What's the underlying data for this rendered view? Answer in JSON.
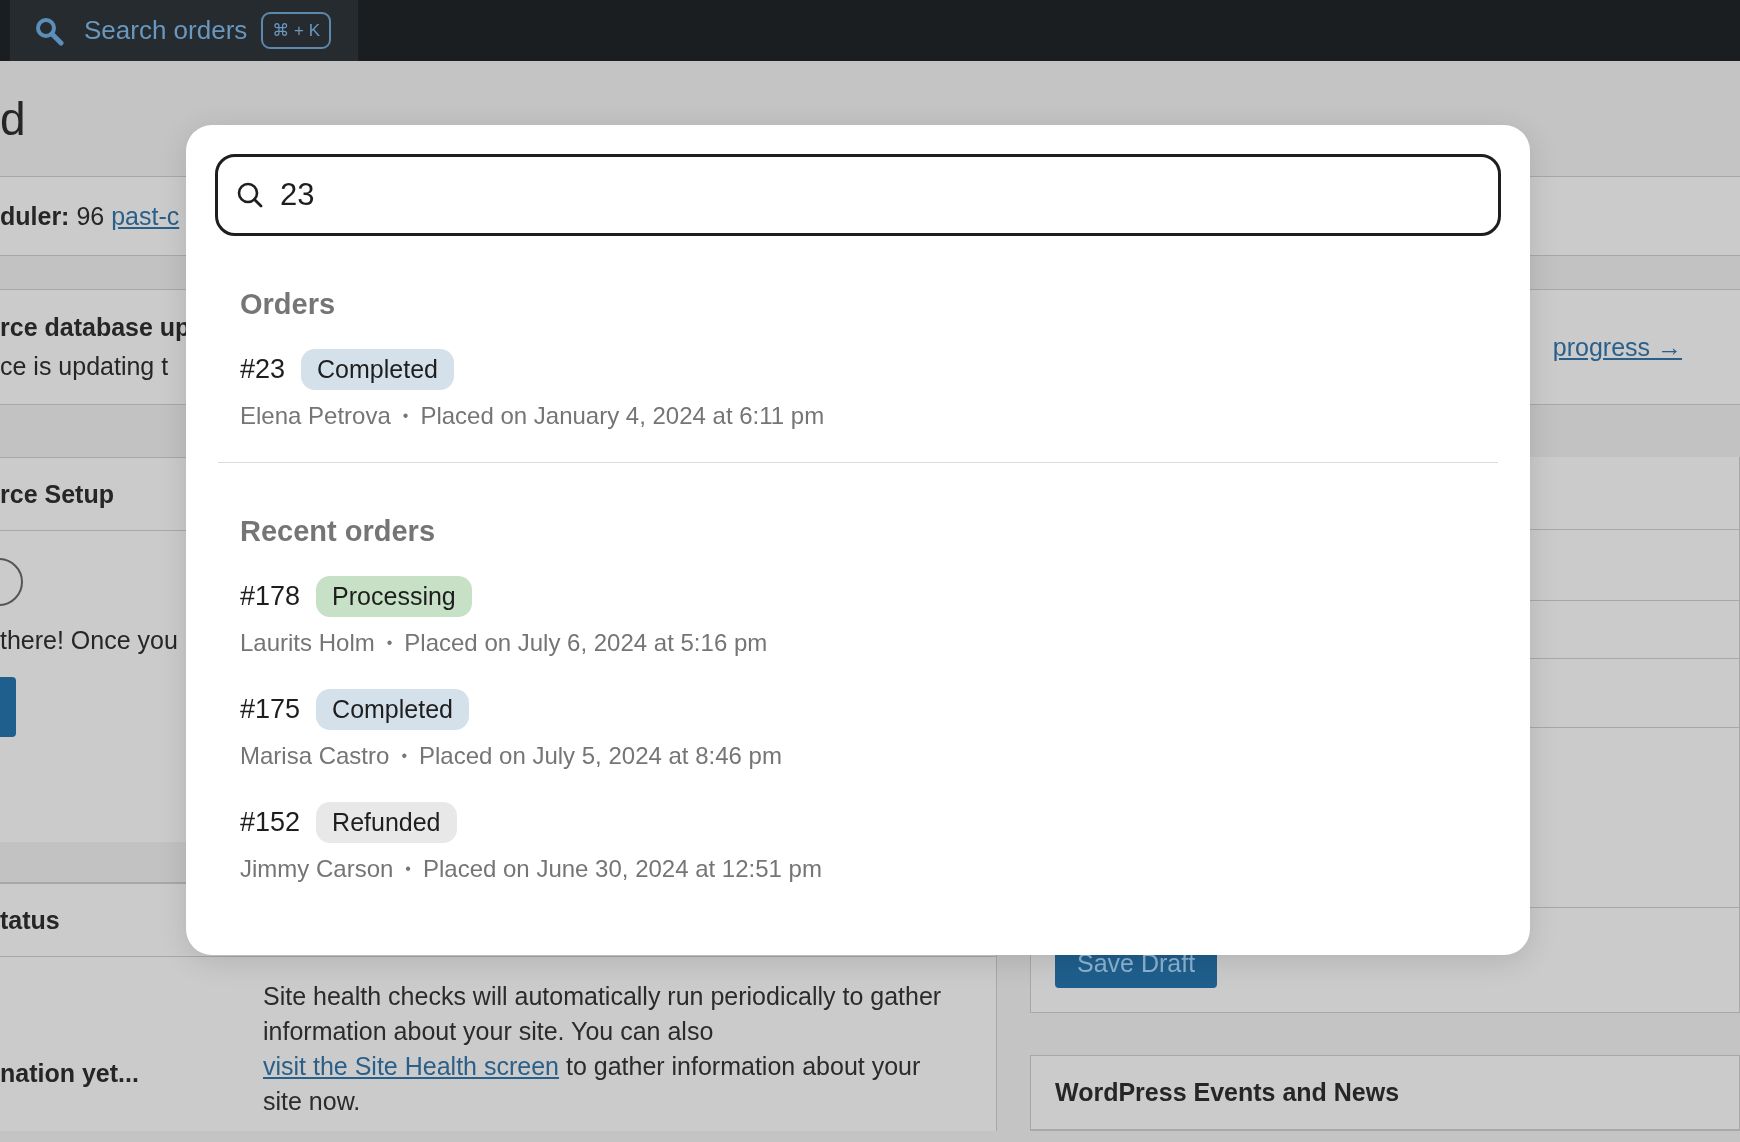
{
  "top_bar": {
    "search_label": "Search orders",
    "shortcut": "⌘ + K"
  },
  "background": {
    "page_title": "d",
    "notice_1": {
      "text": "**duler:** 96 ",
      "link": "past-c"
    },
    "notice_2": {
      "title": "rce database up",
      "text": "ce is updating t",
      "link": "progress →"
    },
    "setup_panel": {
      "title": "rce Setup",
      "text": "there! Once you"
    },
    "status_panel": {
      "title": "tatus",
      "label": "nation yet...",
      "text_before": "Site health checks will automatically run periodically to gather information about your site. You can also ",
      "link": "visit the Site Health screen",
      "text_after": " to gather information about your site now."
    },
    "save_draft": "Save Draft",
    "events_panel": {
      "title": "WordPress Events and News"
    }
  },
  "modal": {
    "query": "23",
    "sections": [
      {
        "title": "Orders",
        "orders": [
          {
            "number": "#23",
            "status": "Completed",
            "kind": "completed",
            "customer": "Elena Petrova",
            "separator": "•",
            "placed": "Placed on January 4, 2024 at 6:11 pm"
          }
        ]
      },
      {
        "title": "Recent orders",
        "orders": [
          {
            "number": "#178",
            "status": "Processing",
            "kind": "processing",
            "customer": "Laurits Holm",
            "separator": "•",
            "placed": "Placed on July 6, 2024 at 5:16 pm"
          },
          {
            "number": "#175",
            "status": "Completed",
            "kind": "completed",
            "customer": "Marisa Castro",
            "separator": "•",
            "placed": "Placed on July 5, 2024 at 8:46 pm"
          },
          {
            "number": "#152",
            "status": "Refunded",
            "kind": "refunded",
            "customer": "Jimmy Carson",
            "separator": "•",
            "placed": "Placed on June 30, 2024 at 12:51 pm"
          }
        ]
      }
    ]
  }
}
